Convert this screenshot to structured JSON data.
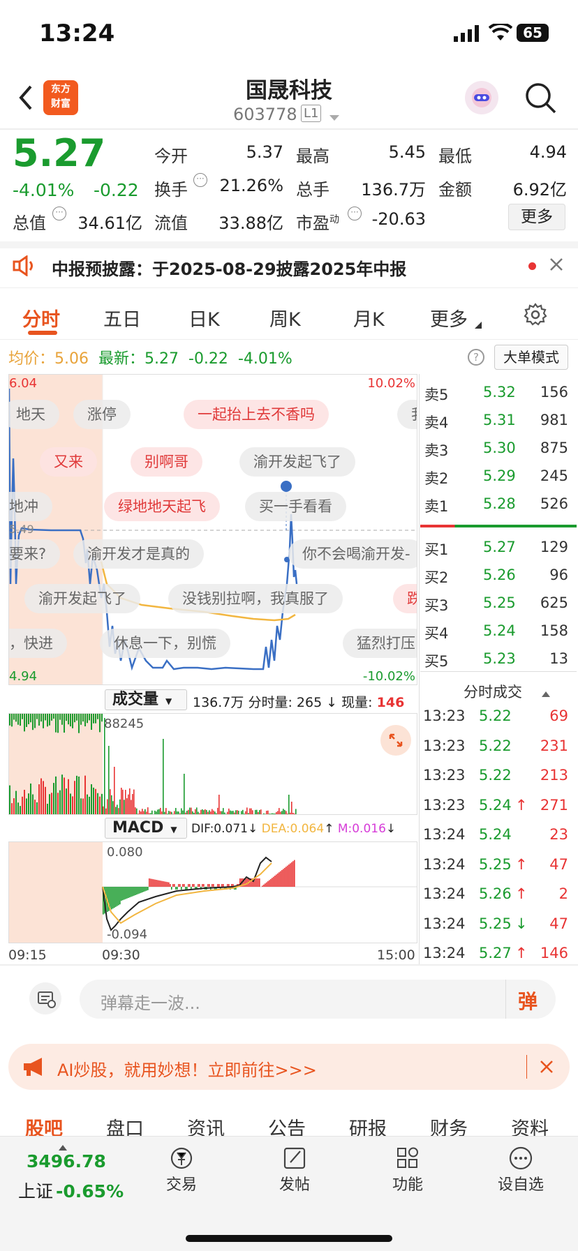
{
  "status_bar": {
    "time": "13:24",
    "battery": "65"
  },
  "header": {
    "title": "国晟科技",
    "code": "603778",
    "level_badge": "L1",
    "logo_line1": "东方",
    "logo_line2": "财富"
  },
  "quote": {
    "price": "5.27",
    "change_pct": "-4.01%",
    "change": "-0.22",
    "open_label": "今开",
    "open": "5.37",
    "high_label": "最高",
    "high": "5.45",
    "low_label": "最低",
    "low": "4.94",
    "turnover_label": "换手",
    "turnover": "21.26%",
    "volume_label": "总手",
    "volume": "136.7万",
    "amount_label": "金额",
    "amount": "6.92亿",
    "mcap_label": "总值",
    "mcap": "34.61亿",
    "float_label": "流值",
    "float": "33.88亿",
    "pe_label": "市盈",
    "pe_sup": "动",
    "pe": "-20.63",
    "more_button": "更多"
  },
  "notice": {
    "text": "中报预披露：于2025-08-29披露2025年中报"
  },
  "tabs": [
    "分时",
    "五日",
    "日K",
    "周K",
    "月K",
    "更多"
  ],
  "chart_info": {
    "avg_label": "均价：",
    "avg": "5.06",
    "latest_label": "最新：",
    "latest": "5.27",
    "chg": "-0.22",
    "pct": "-4.01%",
    "mode_button": "大单模式"
  },
  "price_chart": {
    "top_left": "6.04",
    "top_right": "10.02%",
    "mid_left": "5.49",
    "bottom_left": "4.94",
    "bottom_right": "-10.02%"
  },
  "danmu": [
    {
      "text": "地天",
      "style": "g"
    },
    {
      "text": "涨停",
      "style": "g"
    },
    {
      "text": "一起抬上去不香吗",
      "style": "r"
    },
    {
      "text": "我",
      "style": "g"
    },
    {
      "text": "又来",
      "style": "r"
    },
    {
      "text": "别啊哥",
      "style": "r"
    },
    {
      "text": "渝开发起飞了",
      "style": "g"
    },
    {
      "text": "地冲",
      "style": "g"
    },
    {
      "text": "绿地地天起飞",
      "style": "r"
    },
    {
      "text": "买一手看看",
      "style": "g"
    },
    {
      "text": "要来?",
      "style": "g"
    },
    {
      "text": "渝开发才是真的",
      "style": "g"
    },
    {
      "text": "你不会喝渝开发-",
      "style": "g"
    },
    {
      "text": "渝开发起飞了",
      "style": "g"
    },
    {
      "text": "没钱别拉啊，我真服了",
      "style": "g"
    },
    {
      "text": "跌",
      "style": "r"
    },
    {
      "text": "，快进",
      "style": "g"
    },
    {
      "text": "休息一下，别慌",
      "style": "g"
    },
    {
      "text": "猛烈打压",
      "style": "g"
    }
  ],
  "volume_panel": {
    "label": "成交量",
    "total": "136.7万",
    "min_vol_label": "分时量:",
    "min_vol": "265",
    "cur_label": "现量:",
    "cur": "146",
    "max_label": "88245"
  },
  "macd_panel": {
    "label": "MACD",
    "dif": "DIF:0.071",
    "dea": "DEA:0.064",
    "m": "M:0.016",
    "top": "0.080",
    "bottom": "-0.094"
  },
  "time_axis": {
    "start": "09:15",
    "mid": "09:30",
    "end": "15:00"
  },
  "order_book": {
    "sell": [
      {
        "label": "卖5",
        "price": "5.32",
        "vol": "156"
      },
      {
        "label": "卖4",
        "price": "5.31",
        "vol": "981"
      },
      {
        "label": "卖3",
        "price": "5.30",
        "vol": "875"
      },
      {
        "label": "卖2",
        "price": "5.29",
        "vol": "245"
      },
      {
        "label": "卖1",
        "price": "5.28",
        "vol": "526"
      }
    ],
    "buy": [
      {
        "label": "买1",
        "price": "5.27",
        "vol": "129"
      },
      {
        "label": "买2",
        "price": "5.26",
        "vol": "96"
      },
      {
        "label": "买3",
        "price": "5.25",
        "vol": "625"
      },
      {
        "label": "买4",
        "price": "5.24",
        "vol": "158"
      },
      {
        "label": "买5",
        "price": "5.23",
        "vol": "13"
      }
    ]
  },
  "trades": {
    "title": "分时成交",
    "rows": [
      {
        "time": "13:23",
        "price": "5.22",
        "arrow": "",
        "vol": "69"
      },
      {
        "time": "13:23",
        "price": "5.22",
        "arrow": "",
        "vol": "231"
      },
      {
        "time": "13:23",
        "price": "5.22",
        "arrow": "",
        "vol": "213"
      },
      {
        "time": "13:23",
        "price": "5.24",
        "arrow": "↑",
        "vol": "271"
      },
      {
        "time": "13:24",
        "price": "5.24",
        "arrow": "",
        "vol": "23"
      },
      {
        "time": "13:24",
        "price": "5.25",
        "arrow": "↑",
        "vol": "47"
      },
      {
        "time": "13:24",
        "price": "5.26",
        "arrow": "↑",
        "vol": "2"
      },
      {
        "time": "13:24",
        "price": "5.25",
        "arrow": "↓",
        "vol": "47"
      },
      {
        "time": "13:24",
        "price": "5.27",
        "arrow": "↑",
        "vol": "146"
      }
    ]
  },
  "comment_bar": {
    "placeholder": "弹幕走一波...",
    "send": "弹"
  },
  "ad_banner": {
    "text": "AI炒股，就用妙想！立即前往>>>"
  },
  "sub_tabs": [
    "股吧",
    "盘口",
    "资讯",
    "公告",
    "研报",
    "财务",
    "资料"
  ],
  "bottom_nav": {
    "index_value": "3496.78",
    "index_name": "上证",
    "index_pct": "-0.65%",
    "items": [
      "交易",
      "发帖",
      "功能",
      "设自选"
    ]
  },
  "colors": {
    "up": "#e83434",
    "down": "#1a9b2e",
    "accent": "#e8541f"
  }
}
